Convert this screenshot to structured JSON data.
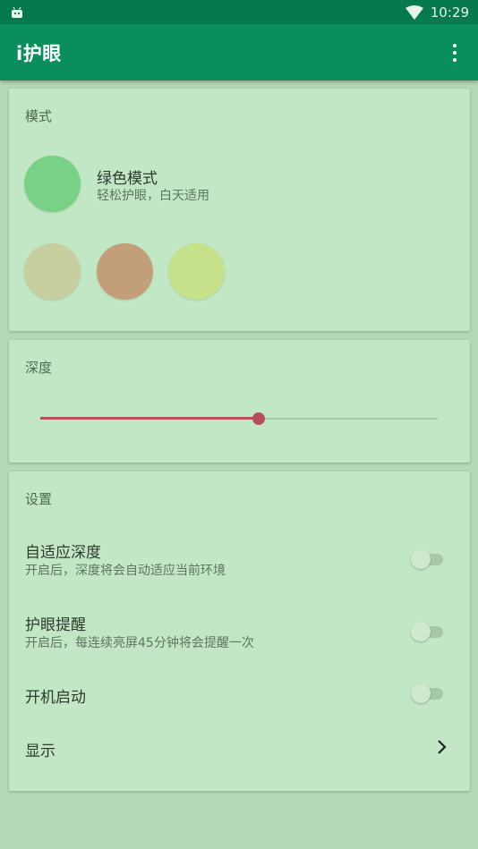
{
  "status_bar": {
    "time": "10:29",
    "notification_icon": "android-icon",
    "signal_icon": "wifi-icon"
  },
  "app_bar": {
    "title": "i护眼",
    "menu_icon": "more-vert-icon"
  },
  "mode_card": {
    "title": "模式",
    "current_mode": {
      "name": "绿色模式",
      "description": "轻松护眼，白天适用",
      "color": "#78d184"
    },
    "options": [
      {
        "color": "#c8cf9f"
      },
      {
        "color": "#c39f79"
      },
      {
        "color": "#c7e08a"
      }
    ]
  },
  "depth_card": {
    "title": "深度",
    "slider": {
      "value": 0.55,
      "track_color": "#a6cba9",
      "fill_color": "#b85058"
    }
  },
  "settings_card": {
    "title": "设置",
    "items": [
      {
        "label": "自适应深度",
        "description": "开启后，深度将会自动适应当前环境",
        "toggle": false
      },
      {
        "label": "护眼提醒",
        "description": "开启后，每连续亮屏45分钟将会提醒一次",
        "toggle": false
      },
      {
        "label": "开机启动",
        "toggle": false
      },
      {
        "label": "显示",
        "action_icon": "chevron-right-icon"
      }
    ]
  },
  "colors": {
    "status_bar": "#067a4c",
    "app_bar": "#0a8f5c",
    "background": "#b3d9b5",
    "card": "#c1e7c4",
    "accent": "#b84e5a"
  }
}
